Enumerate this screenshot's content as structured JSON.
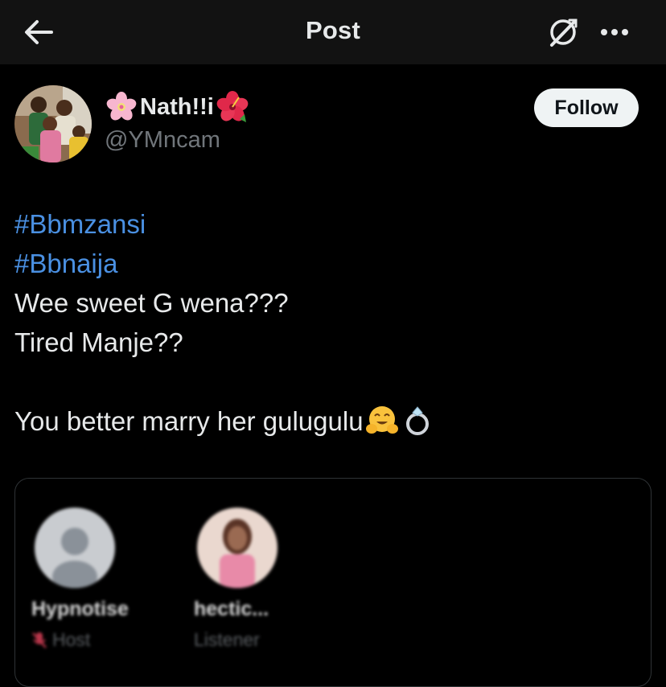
{
  "header": {
    "title": "Post",
    "back_icon": "arrow-left-icon",
    "grok_icon": "grok-icon",
    "more_icon": "more-horizontal-icon"
  },
  "author": {
    "name": "Nath!!i",
    "name_prefix_emoji": "cherry-blossom",
    "name_suffix_emoji": "hibiscus",
    "handle": "@YMncam",
    "follow_label": "Follow"
  },
  "tweet": {
    "hashtags": [
      "#Bbmzansi",
      "#Bbnaija"
    ],
    "line1": "Wee sweet G wena???",
    "line2": "Tired Manje??",
    "line3": "You better marry her gulugulu",
    "line3_emojis": [
      "hugging-face",
      "ring"
    ]
  },
  "space": {
    "participants": [
      {
        "name": "Hypnotise",
        "role": "Host",
        "role_icon": "mic-muted-icon"
      },
      {
        "name": "hectic...",
        "role": "Listener"
      }
    ]
  },
  "colors": {
    "background": "#000000",
    "header": "#121212",
    "text": "#e7e9ea",
    "secondary": "#71767b",
    "link": "#4a90e2",
    "follow_bg": "#eff3f4",
    "card_border": "#2f3336"
  }
}
